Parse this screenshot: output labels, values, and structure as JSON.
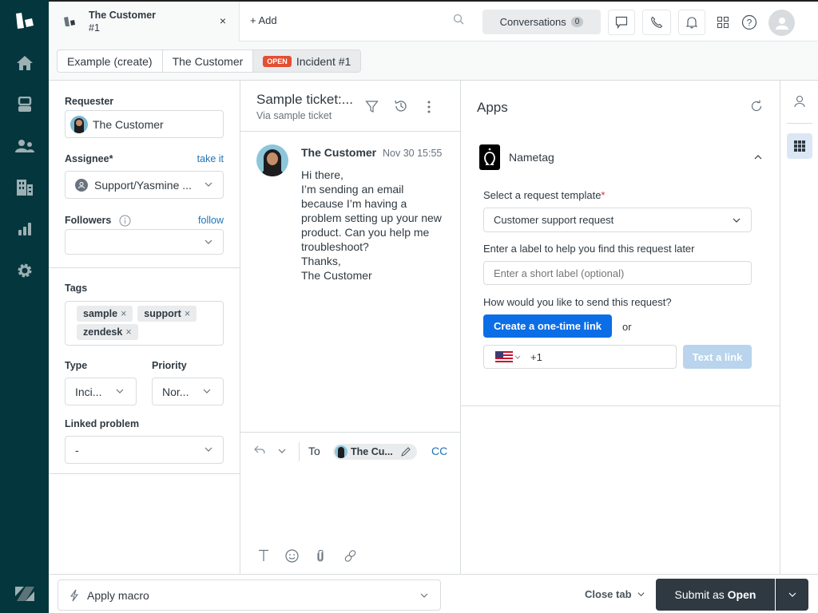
{
  "topbar": {
    "tab": {
      "title": "The Customer",
      "subtitle": "#1",
      "close": "×"
    },
    "add_label": "Add",
    "conversations_label": "Conversations",
    "conversations_count": "0"
  },
  "breadcrumbs": [
    {
      "label": "Example (create)"
    },
    {
      "label": "The Customer"
    },
    {
      "badge": "OPEN",
      "label": "Incident #1"
    }
  ],
  "left_panel": {
    "requester_label": "Requester",
    "requester_value": "The Customer",
    "assignee_label": "Assignee*",
    "assignee_link": "take it",
    "assignee_value": "Support/Yasmine ...",
    "followers_label": "Followers",
    "followers_link": "follow",
    "followers_value": "",
    "tags_label": "Tags",
    "tags": [
      "sample",
      "support",
      "zendesk"
    ],
    "type_label": "Type",
    "type_value": "Inci...",
    "priority_label": "Priority",
    "priority_value": "Nor...",
    "linked_problem_label": "Linked problem",
    "linked_problem_value": "-"
  },
  "conversation": {
    "title": "Sample ticket:...",
    "via": "Via sample ticket",
    "message": {
      "author": "The Customer",
      "time": "Nov 30 15:55",
      "lines": [
        "Hi there,",
        "I’m sending an email because I’m having a problem setting up your new product. Can you help me troubleshoot?",
        "Thanks,",
        "The Customer"
      ]
    },
    "compose": {
      "to_label": "To",
      "recipient": "The Cu...",
      "cc_label": "CC"
    }
  },
  "apps": {
    "title": "Apps",
    "app_name": "Nametag",
    "template_label": "Select a request template",
    "required_marker": "*",
    "template_value": "Customer support request",
    "label_prompt": "Enter a label to help you find this request later",
    "label_placeholder": "Enter a short label (optional)",
    "send_prompt": "How would you like to send this request?",
    "create_link_button": "Create a one-time link",
    "or_text": "or",
    "phone_prefix": "+1",
    "text_link_button": "Text a link"
  },
  "bottom": {
    "macro_label": "Apply macro",
    "close_tab_label": "Close tab",
    "submit_prefix": "Submit as ",
    "submit_status": "Open"
  },
  "colors": {
    "nav_bg": "#03363d",
    "primary": "#1f73b7",
    "open_badge": "#e34f32",
    "submit_bg": "#2f3941"
  }
}
